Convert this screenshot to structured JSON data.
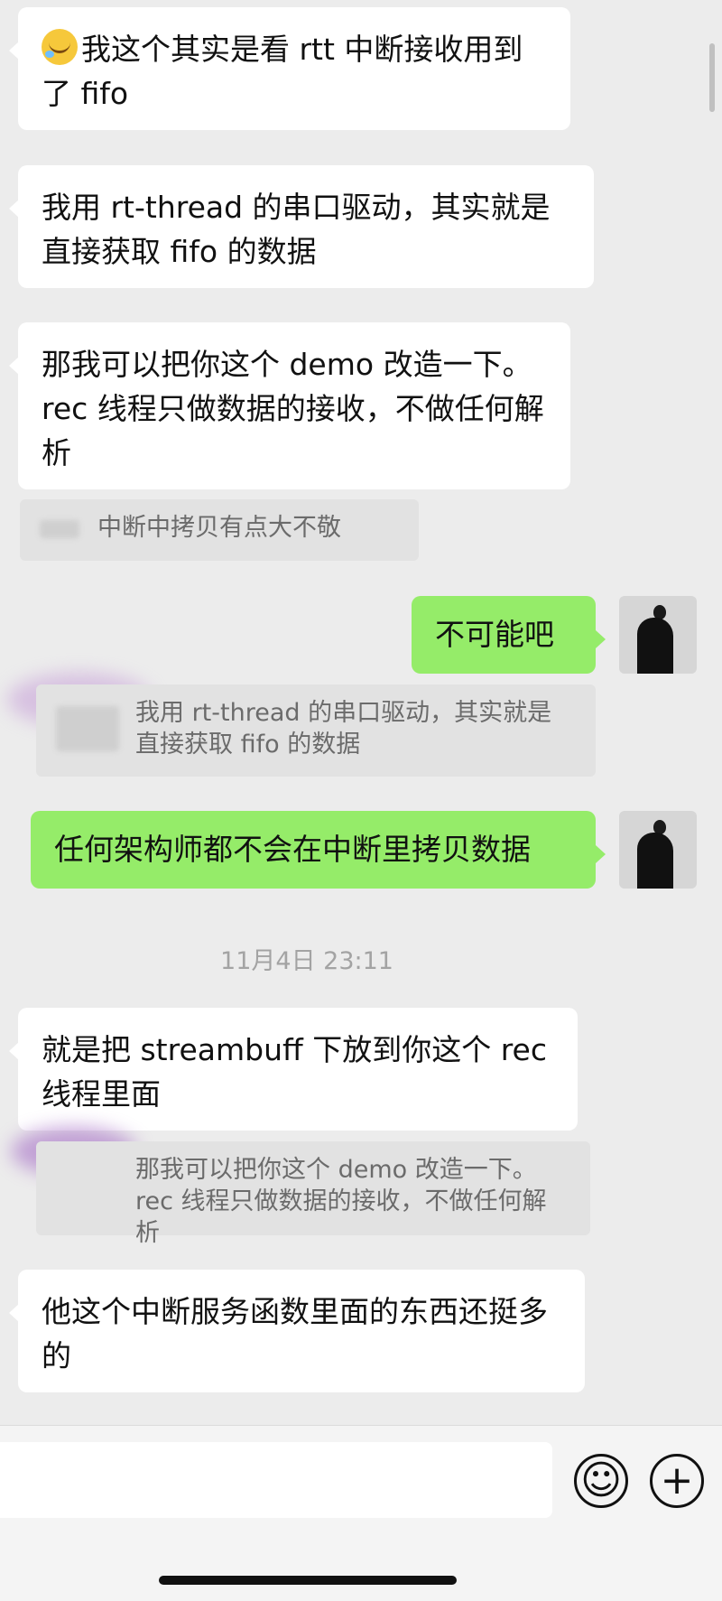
{
  "messages": [
    {
      "side": "left",
      "emoji": "face-with-tears-icon",
      "text": "我这个其实是看 rtt 中断接收用到了 fifo"
    },
    {
      "side": "left",
      "text": "我用 rt-thread 的串口驱动，其实就是直接获取 fifo 的数据"
    },
    {
      "side": "left",
      "text": "那我可以把你这个 demo 改造一下。rec 线程只做数据的接收，不做任何解析"
    },
    {
      "side": "left",
      "type": "quote",
      "text": "中断中拷贝有点大不敬"
    },
    {
      "side": "right",
      "text": "不可能吧"
    },
    {
      "side": "right",
      "type": "quote",
      "text": "我用 rt-thread 的串口驱动，其实就是直接获取 fifo 的数据"
    },
    {
      "side": "right",
      "text": "任何架构师都不会在中断里拷贝数据"
    },
    {
      "side": "left",
      "text": "就是把 streambuff 下放到你这个 rec 线程里面"
    },
    {
      "side": "left",
      "type": "quote",
      "text": "那我可以把你这个 demo 改造一下。rec 线程只做数据的接收，不做任何解析"
    },
    {
      "side": "left",
      "text": "他这个中断服务函数里面的东西还挺多的"
    }
  ],
  "timestamp": "11月4日 23:11",
  "input": {
    "placeholder": "",
    "emoji_button_icon": "smiley-icon",
    "more_button_icon": "plus-icon"
  },
  "colors": {
    "background": "#ececec",
    "incoming_bubble": "#ffffff",
    "outgoing_bubble": "#95ec69",
    "quote_bg": "#e2e2e2"
  }
}
